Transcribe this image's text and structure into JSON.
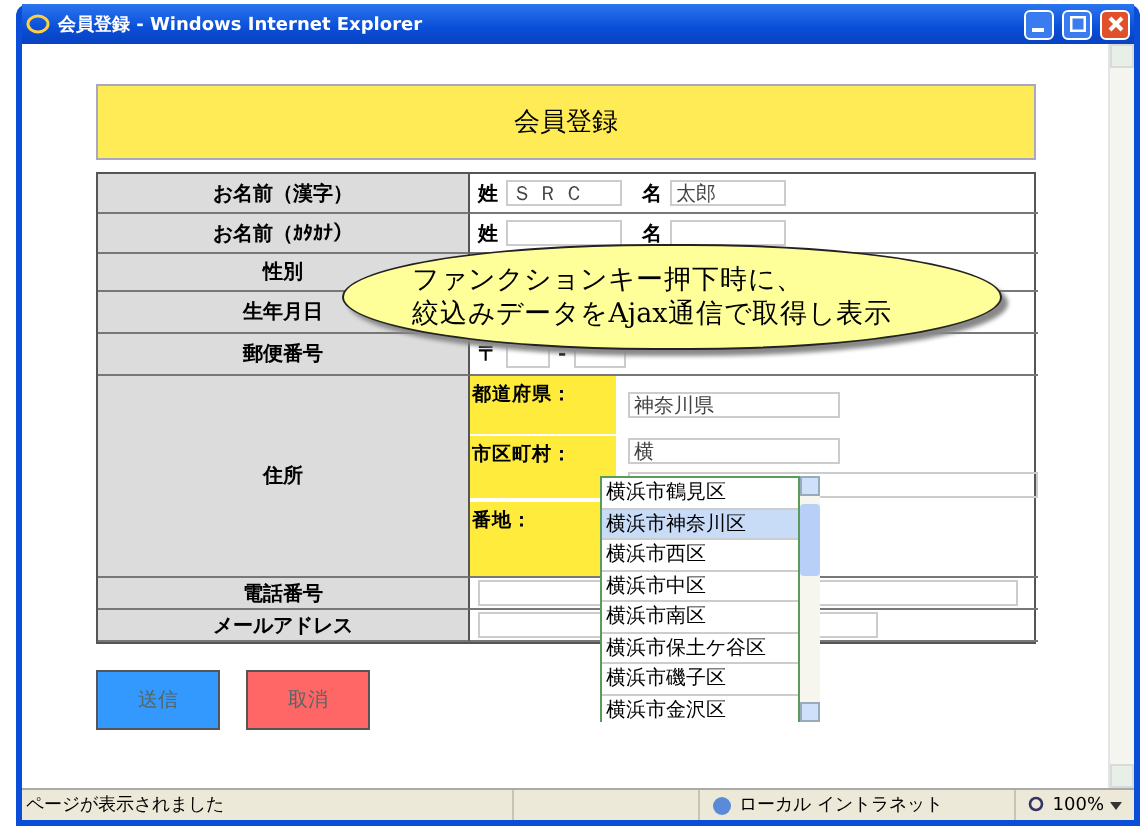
{
  "window": {
    "title": "会員登録 - Windows Internet Explorer"
  },
  "page_title": "会員登録",
  "form_rows": [
    {
      "label": "お名前（漢字）",
      "kind": "name",
      "last_label": "姓",
      "last_value": "ＳＲＣ",
      "first_label": "名",
      "first_value": "太郎"
    },
    {
      "label": "お名前（ｶﾀｶﾅ）",
      "kind": "name",
      "last_label": "姓",
      "first_label": "名"
    },
    {
      "label": "性別",
      "kind": "blank"
    },
    {
      "label": "生年月日",
      "kind": "blank"
    },
    {
      "label": "郵便番号",
      "kind": "zip",
      "zip_mark": "〒",
      "separator": "-"
    },
    {
      "label": "住所",
      "kind": "address",
      "parts": [
        {
          "label": "都道府県：",
          "value": "神奈川県"
        },
        {
          "label": "市区町村：",
          "value": "横"
        },
        {
          "label": "番地："
        }
      ]
    },
    {
      "label": "電話番号",
      "kind": "wide"
    },
    {
      "label": "メールアドレス",
      "kind": "wide"
    }
  ],
  "suggestions": [
    {
      "text": "横浜市鶴見区",
      "selected": false
    },
    {
      "text": "横浜市神奈川区",
      "selected": true
    },
    {
      "text": "横浜市西区",
      "selected": false
    },
    {
      "text": "横浜市中区",
      "selected": false
    },
    {
      "text": "横浜市南区",
      "selected": false
    },
    {
      "text": "横浜市保土ケ谷区",
      "selected": false
    },
    {
      "text": "横浜市磯子区",
      "selected": false
    },
    {
      "text": "横浜市金沢区",
      "selected": false
    }
  ],
  "callout": [
    "ファンクションキー押下時に、",
    "絞込みデータをAjax通信で取得し表示"
  ],
  "buttons": [
    {
      "label": "送信",
      "kind": "submit"
    },
    {
      "label": "取消",
      "kind": "cancel"
    }
  ],
  "status_bar": {
    "message": "ページが表示されました",
    "zone": "ローカル イントラネット",
    "zoom": "100%"
  }
}
